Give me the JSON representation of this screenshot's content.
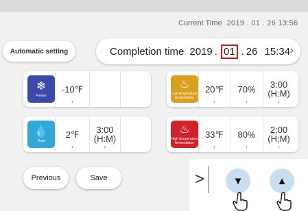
{
  "header": {
    "current_time_label": "Current Time",
    "current_time_value": "2019 . 01 . 26  13:56"
  },
  "buttons": {
    "automatic_setting": "Automatic setting",
    "previous": "Previous",
    "save": "Save"
  },
  "completion": {
    "label": "Completion time",
    "year": "2019",
    "sep": ".",
    "month": "01",
    "day": "26",
    "time": "15:34",
    "chevron": "›"
  },
  "modes": {
    "freeze": {
      "label": "Freeze",
      "icon": "snowflake-icon",
      "color": "#3c49a7",
      "temperature": "-10℉",
      "chevron": "›"
    },
    "thaw": {
      "label": "Thaw",
      "icon": "droplet-icon",
      "color": "#33a8d6",
      "temperature": "2℉",
      "duration_line1": "3:00",
      "duration_line2": "(H:M)",
      "chevron": "›"
    },
    "low_fermentation": {
      "label": "Low temperature fermentation",
      "icon": "bread-low-icon",
      "color": "#d9a020",
      "temperature": "20℉",
      "humidity": "70%",
      "duration_line1": "3:00",
      "duration_line2": "(H:M)",
      "chevron": "›"
    },
    "high_fermentation": {
      "label": "High temperature fermentation",
      "icon": "bread-high-icon",
      "color": "#d1222c",
      "temperature": "33℉",
      "humidity": "80%",
      "duration_line1": "2:00",
      "duration_line2": "(H:M)",
      "chevron": "›"
    }
  },
  "controls": {
    "next_glyph": ">",
    "down_glyph": "▼",
    "up_glyph": "▲"
  }
}
